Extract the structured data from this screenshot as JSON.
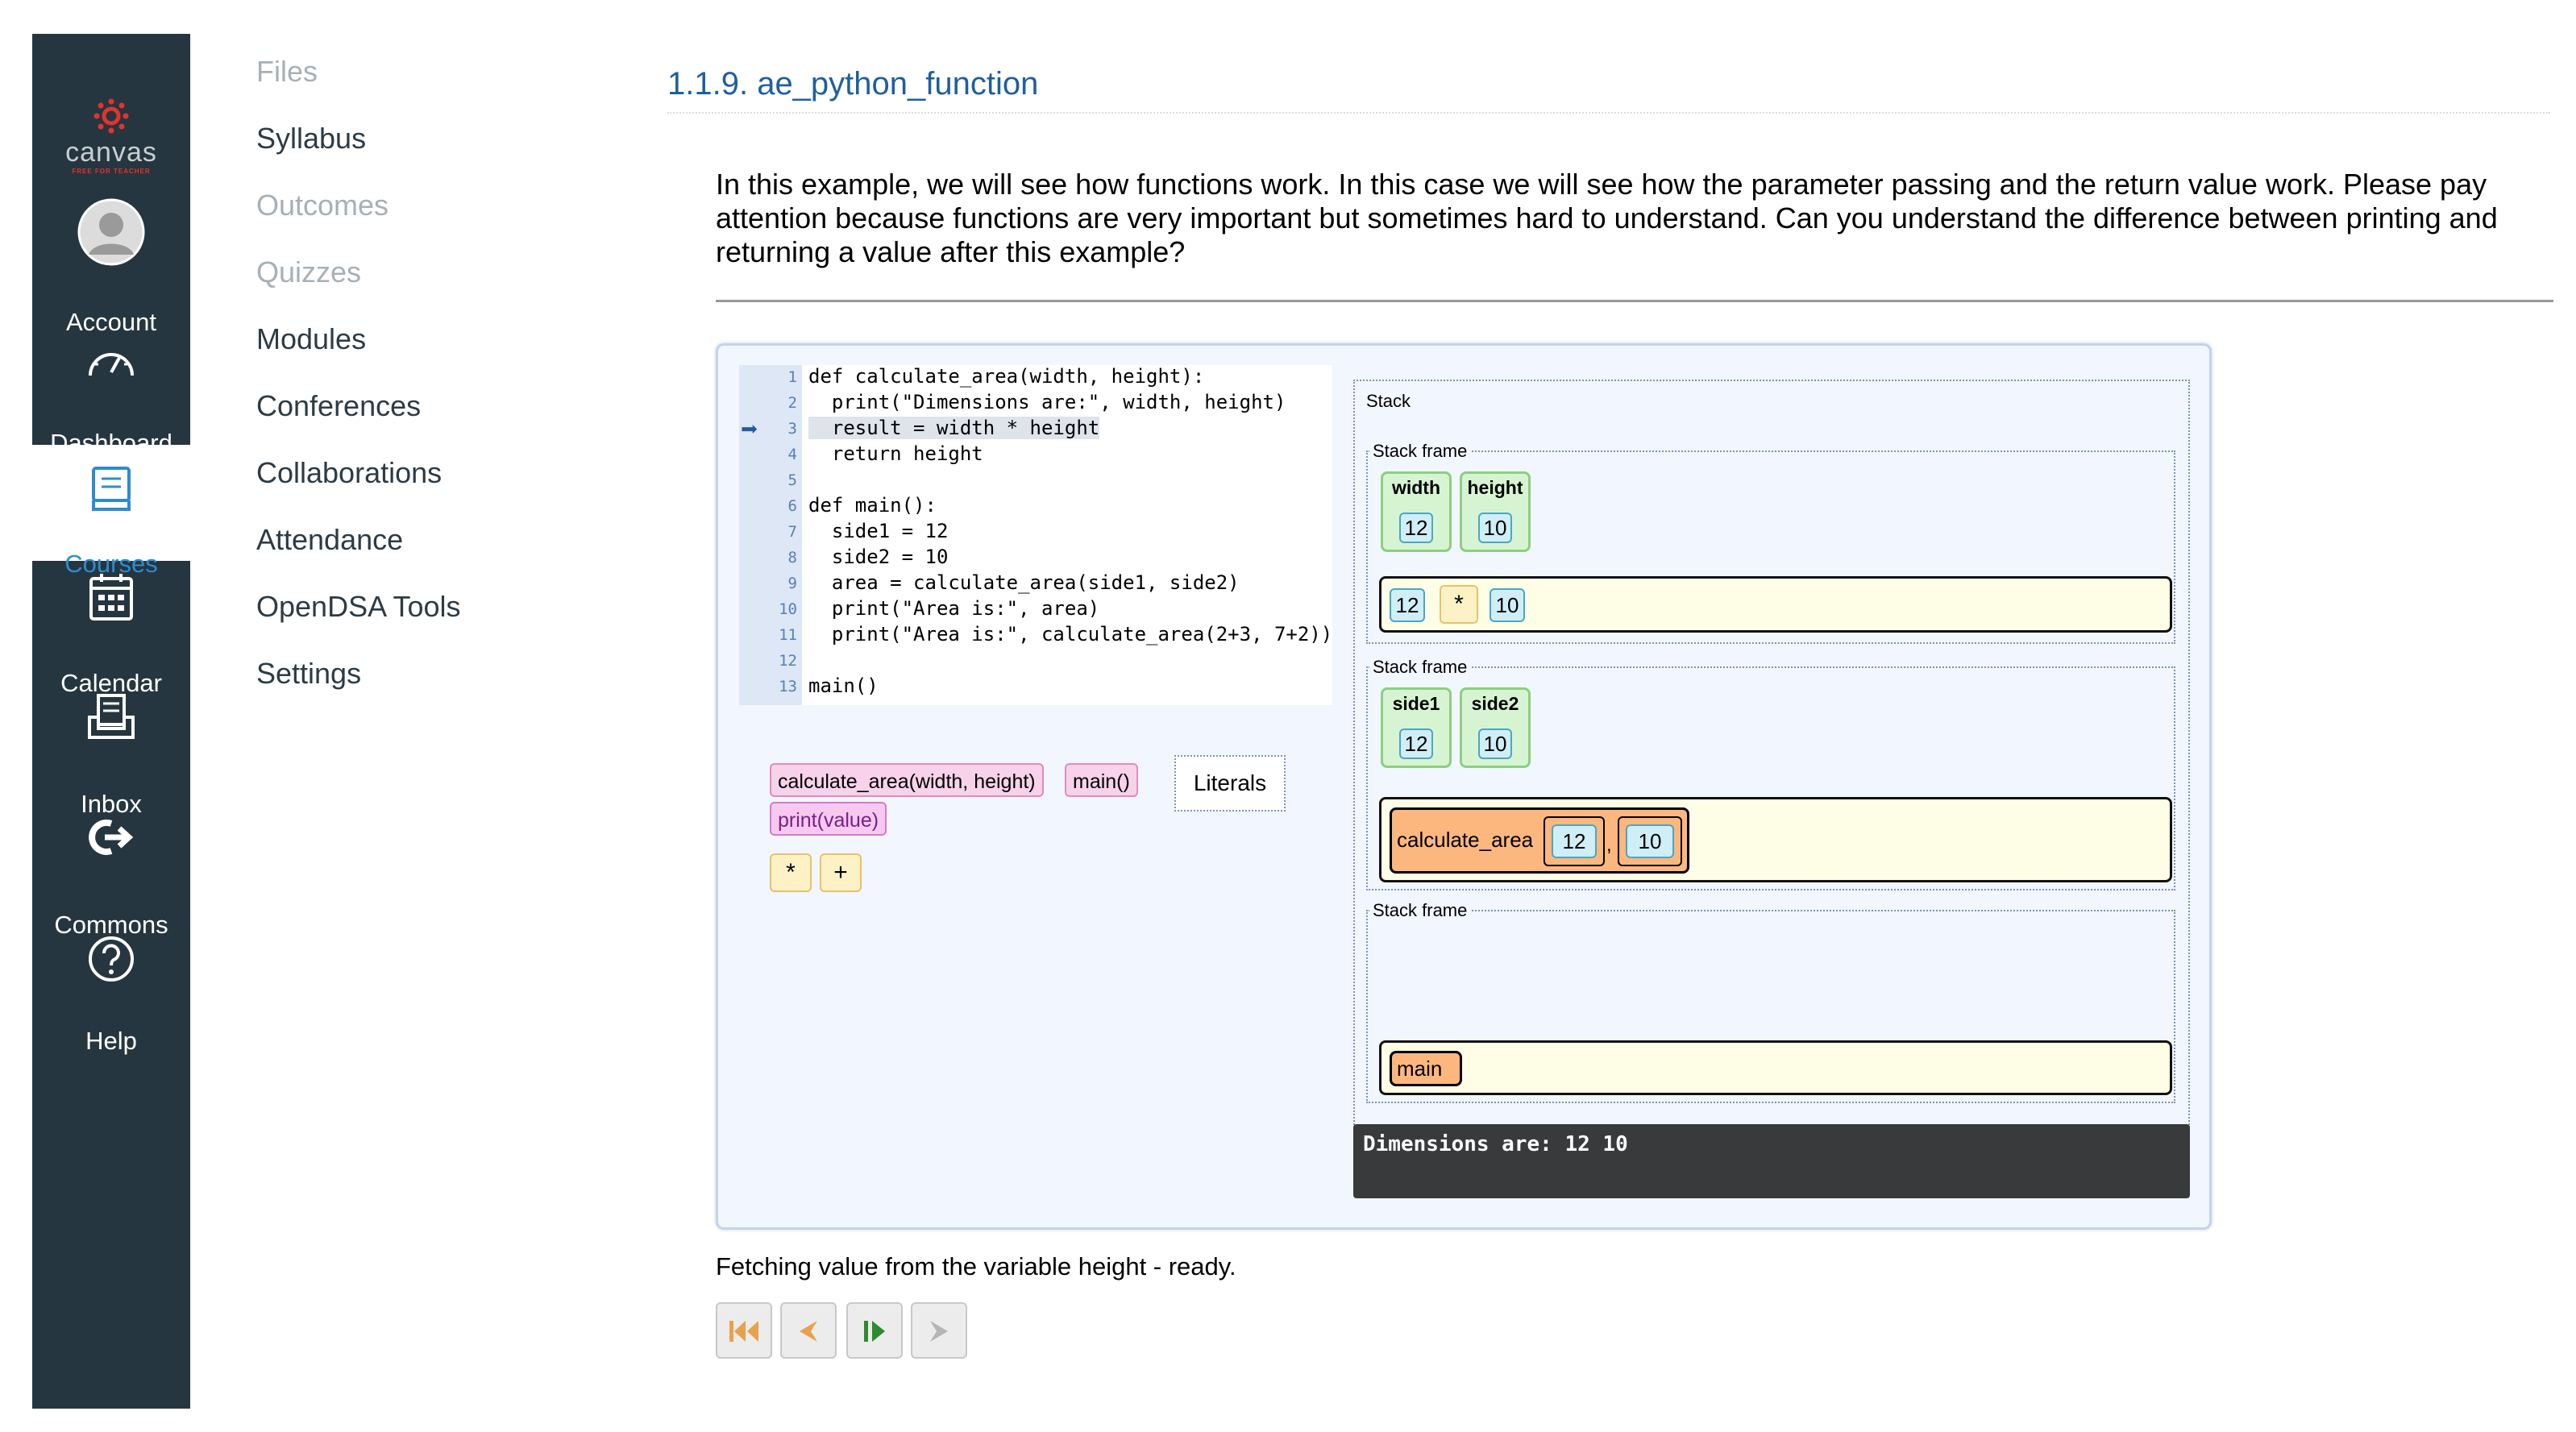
{
  "global_nav": {
    "logo_word": "canvas",
    "logo_tag": "FREE FOR TEACHER",
    "items": [
      {
        "label": "Account",
        "icon": "account-icon"
      },
      {
        "label": "Dashboard",
        "icon": "dashboard-icon"
      },
      {
        "label": "Courses",
        "icon": "courses-icon",
        "active": true
      },
      {
        "label": "Calendar",
        "icon": "calendar-icon"
      },
      {
        "label": "Inbox",
        "icon": "inbox-icon"
      },
      {
        "label": "Commons",
        "icon": "commons-icon"
      },
      {
        "label": "Help",
        "icon": "help-icon"
      }
    ],
    "colors": {
      "background": "#263640",
      "active_text": "#2d8cd0",
      "logo_red": "#e0342c"
    }
  },
  "course_nav": [
    {
      "label": "Files",
      "disabled": true
    },
    {
      "label": "Syllabus",
      "disabled": false
    },
    {
      "label": "Outcomes",
      "disabled": true
    },
    {
      "label": "Quizzes",
      "disabled": true
    },
    {
      "label": "Modules",
      "disabled": false
    },
    {
      "label": "Conferences",
      "disabled": false
    },
    {
      "label": "Collaborations",
      "disabled": false
    },
    {
      "label": "Attendance",
      "disabled": false
    },
    {
      "label": "OpenDSA Tools",
      "disabled": false
    },
    {
      "label": "Settings",
      "disabled": false
    }
  ],
  "content": {
    "section_title": "1.1.9. ae_python_function",
    "intro": "In this example, we will see how functions work. In this case we will see how the parameter passing and the return value work. Please pay attention because functions are very important but sometimes hard to understand. Can you understand the difference between printing and returning a value after this example?"
  },
  "code": {
    "current_line": 3,
    "lines": [
      {
        "n": "1",
        "text": "def calculate_area(width, height):"
      },
      {
        "n": "2",
        "text": "  print(\"Dimensions are:\", width, height)"
      },
      {
        "n": "3",
        "text": "  result = width * height"
      },
      {
        "n": "4",
        "text": "  return height"
      },
      {
        "n": "5",
        "text": ""
      },
      {
        "n": "6",
        "text": "def main():"
      },
      {
        "n": "7",
        "text": "  side1 = 12"
      },
      {
        "n": "8",
        "text": "  side2 = 10"
      },
      {
        "n": "9",
        "text": "  area = calculate_area(side1, side2)"
      },
      {
        "n": "10",
        "text": "  print(\"Area is:\", area)"
      },
      {
        "n": "11",
        "text": "  print(\"Area is:\", calculate_area(2+3, 7+2))"
      },
      {
        "n": "12",
        "text": ""
      },
      {
        "n": "13",
        "text": "main()"
      }
    ]
  },
  "palette": {
    "blocks": [
      "calculate_area(width, height)",
      "main()",
      "print(value)"
    ],
    "operators": [
      "*",
      "+"
    ],
    "literals_label": "Literals"
  },
  "stack": {
    "label": "Stack",
    "frame_label": "Stack frame",
    "frames": [
      {
        "vars": [
          {
            "name": "width",
            "value": "12"
          },
          {
            "name": "height",
            "value": "10"
          }
        ],
        "expression": [
          "12",
          "*",
          "10"
        ]
      },
      {
        "vars": [
          {
            "name": "side1",
            "value": "12"
          },
          {
            "name": "side2",
            "value": "10"
          }
        ],
        "call": {
          "name": "calculate_area",
          "args": [
            "12",
            "10"
          ],
          "separator": ","
        }
      },
      {
        "vars": [],
        "call": {
          "name": "main"
        }
      }
    ]
  },
  "console": {
    "output": "Dimensions are: 12 10"
  },
  "status": "Fetching value from the variable height - ready.",
  "controls": [
    {
      "name": "first-step-button",
      "glyph": "⏮"
    },
    {
      "name": "prev-step-button",
      "glyph": "◀"
    },
    {
      "name": "next-step-button",
      "glyph": "▶"
    },
    {
      "name": "last-step-button",
      "glyph": "▶"
    }
  ]
}
